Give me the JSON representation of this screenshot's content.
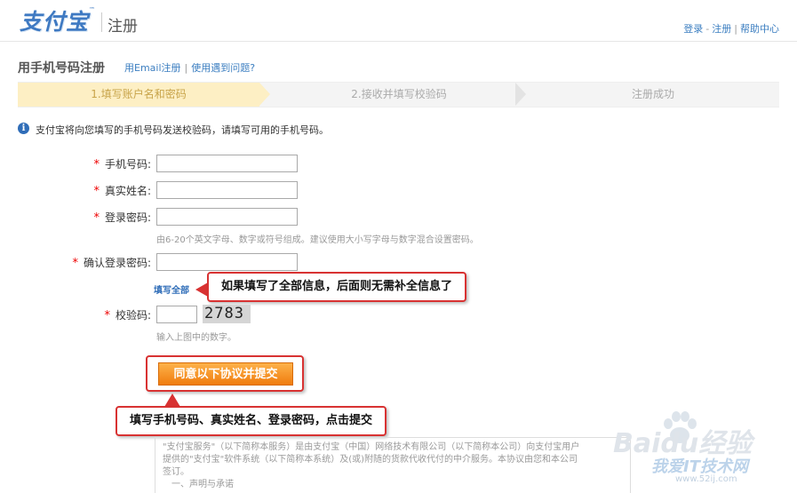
{
  "header": {
    "logo": "支付宝",
    "logo_tm": "™",
    "page_name": "注册",
    "links": [
      "登录",
      "注册",
      "帮助中心"
    ]
  },
  "section": {
    "title": "用手机号码注册",
    "link_email": "用Email注册",
    "link_help": "使用遇到问题?"
  },
  "steps": [
    "1.填写账户名和密码",
    "2.接收并填写校验码",
    "注册成功"
  ],
  "info_text": "支付宝将向您填写的手机号码发送校验码，请填写可用的手机号码。",
  "form": {
    "required_mark": "*",
    "phone_label": "手机号码:",
    "name_label": "真实姓名:",
    "password_label": "登录密码:",
    "password_hint": "由6-20个英文字母、数字或符号组成。建议使用大小写字母与数字混合设置密码。",
    "confirm_label": "确认登录密码:",
    "fill_all": "填写全部",
    "captcha_label": "校验码:",
    "captcha_image_text": "2783",
    "captcha_hint": "输入上图中的数字。",
    "submit_label": "同意以下协议并提交"
  },
  "callouts": {
    "fill_all_note": "如果填写了全部信息，后面则无需补全信息了",
    "submit_note": "填写手机号码、真实姓名、登录密码，点击提交"
  },
  "agreement": {
    "line1": "\"支付宝服务\"（以下简称本服务）是由支付宝（中国）网络技术有限公司（以下简称本公司）向支付宝用户",
    "line2": "提供的\"支付宝\"软件系统（以下简称本系统）及(或)附随的货款代收代付的中介服务。本协议由您和本公司",
    "line3": "签订。",
    "line4": "一、声明与承诺"
  },
  "watermark": {
    "brand": "Baidu经验",
    "site": "我爱IT技术网",
    "url": "www.52ij.com"
  }
}
